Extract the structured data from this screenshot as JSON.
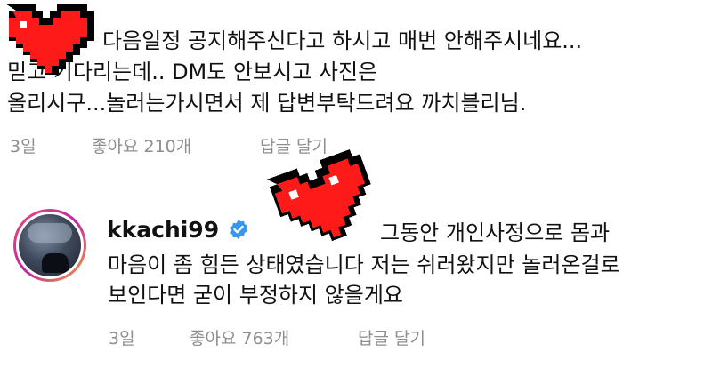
{
  "comment1": {
    "lines": [
      "다음일정 공지해주신다고 하시고 매번 안해주시네요...",
      "믿고 기다리는데.. DM도 안보시고 사진은",
      "올리시구...놀러는가시면서 제 답변부탁드려요 까치블리님."
    ],
    "time": "3일",
    "likes_label": "좋아요 210개",
    "reply_label": "답글 달기"
  },
  "comment2": {
    "username": "kkachi99",
    "lines": [
      "그동안 개인사정으로 몸과",
      "마음이 좀 힘든 상태였습니다 저는 쉬러왔지만 놀러온걸로",
      "보인다면 굳이 부정하지 않을게요"
    ],
    "time": "3일",
    "likes_label": "좋아요 763개",
    "reply_label": "답글 달기"
  },
  "colors": {
    "meta_gray": "#8e8e8e",
    "verified_blue": "#3797f0",
    "heart_red": "#ff1a1a"
  }
}
